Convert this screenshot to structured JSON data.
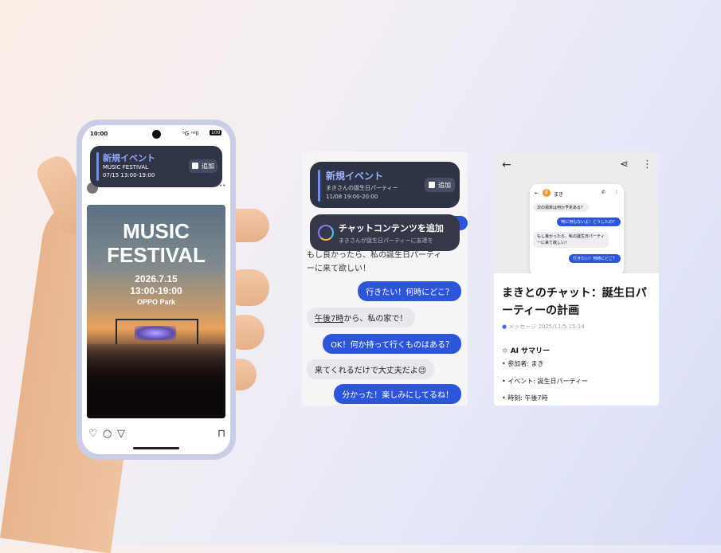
{
  "phone": {
    "status_time": "10:00",
    "status_icons": "⁵G ᴴᵈll",
    "battery": "100",
    "notification": {
      "title": "新規イベント",
      "line1": "MUSIC FESTIVAL",
      "line2": "07/15 13:00-19:00",
      "action": "追加"
    },
    "poster": {
      "title1": "MUSIC",
      "title2": "FESTIVAL",
      "date": "2026.7.15",
      "time": "13:00-19:00",
      "place": "OPPO Park"
    },
    "icons": [
      "heart-icon",
      "comment-icon",
      "send-icon",
      "bookmark-icon"
    ]
  },
  "chat_card": {
    "notification": {
      "title": "新規イベント",
      "line1": "まきさんの誕生日パーティー",
      "line2": "11/08 19:00-20:00",
      "action": "追加"
    },
    "ai_banner": {
      "title": "チャットコンテンツを追加",
      "subtitle": "まきさんが誕生日パーティーに友達を"
    },
    "messages": [
      {
        "from": "them",
        "text1": "もし良かったら、私の誕生日パーティ",
        "text2": "ーに来て欲しい！"
      },
      {
        "from": "me",
        "text": "行きたい！何時にどこ？"
      },
      {
        "from": "them",
        "text_link": "午後7時",
        "text": "から、私の家で！"
      },
      {
        "from": "me",
        "text": "OK！何か持って行くものはある？"
      },
      {
        "from": "them",
        "text": "来てくれるだけで大丈夫だよ😉"
      },
      {
        "from": "me",
        "text": "分かった！楽しみにしてるね！"
      }
    ]
  },
  "summary_card": {
    "mini_chat": {
      "contact": "まき",
      "avatar_letter": "ま",
      "msgs": [
        "次の週末は何か予定ある？",
        "特に何もないよ！どうしたの？",
        "もし良かったら、私の誕生日パーティ",
        "ーに来て欲しい！",
        "行きたい！何時にどこ？"
      ]
    },
    "title": "まきとのチャット：誕生日パーティーの計画",
    "meta": "メッセージ  2025/11/5 15:14",
    "ai_label": "AI サマリー",
    "items": [
      "参加者: まき",
      "イベント: 誕生日パーティー",
      "時刻: 午後7時"
    ]
  },
  "colors": {
    "accent": "#2c55d8",
    "dark_notif": "#2e3346",
    "orange_avatar": "#f0962e"
  }
}
